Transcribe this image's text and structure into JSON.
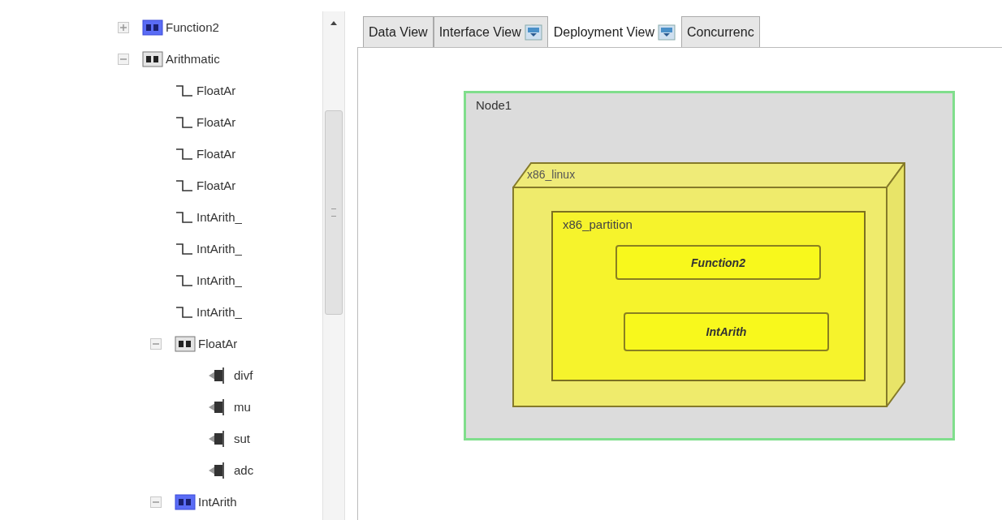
{
  "tree": [
    {
      "kind": "component",
      "label": "Function2",
      "expanded": false,
      "highlighted": true
    },
    {
      "kind": "component",
      "label": "Arithmatic",
      "expanded": true,
      "highlighted": false,
      "children": [
        {
          "kind": "port",
          "label": "FloatAr"
        },
        {
          "kind": "port",
          "label": "FloatAr"
        },
        {
          "kind": "port",
          "label": "FloatAr"
        },
        {
          "kind": "port",
          "label": "FloatAr"
        },
        {
          "kind": "port",
          "label": "IntArith_"
        },
        {
          "kind": "port",
          "label": "IntArith_"
        },
        {
          "kind": "port",
          "label": "IntArith_"
        },
        {
          "kind": "port",
          "label": "IntArith_"
        },
        {
          "kind": "component",
          "label": "FloatAr",
          "expanded": true,
          "highlighted": false,
          "children": [
            {
              "kind": "interface",
              "label": "divf"
            },
            {
              "kind": "interface",
              "label": "mu"
            },
            {
              "kind": "interface",
              "label": "sut"
            },
            {
              "kind": "interface",
              "label": "adc"
            }
          ]
        },
        {
          "kind": "component",
          "label": "IntArith",
          "expanded": true,
          "highlighted": true
        }
      ]
    }
  ],
  "tabs": [
    {
      "label": "Data View",
      "selected": false,
      "icon": false
    },
    {
      "label": "Interface View",
      "selected": false,
      "icon": true
    },
    {
      "label": "Deployment View",
      "selected": true,
      "icon": true
    },
    {
      "label": "Concurrenc",
      "selected": false,
      "icon": false
    }
  ],
  "diagram": {
    "node": {
      "label": "Node1",
      "device": {
        "label": "x86_linux",
        "partition": {
          "label": "x86_partition",
          "functions": [
            "Function2",
            "IntArith"
          ]
        }
      }
    }
  }
}
